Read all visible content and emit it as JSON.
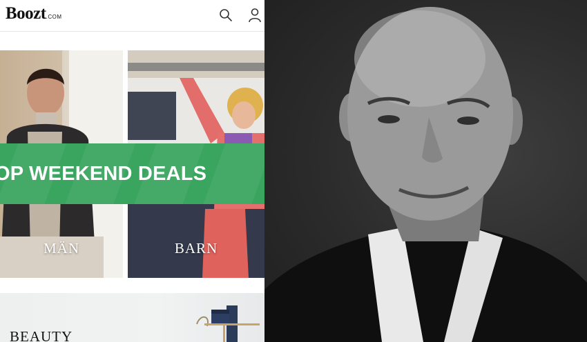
{
  "app": {
    "logo_text": "Boozt",
    "logo_suffix": ".COM"
  },
  "header": {
    "icons": [
      "search-icon",
      "user-icon"
    ]
  },
  "tiles": [
    {
      "label": "MÄN"
    },
    {
      "label": "BARN"
    },
    {
      "label": "BEAUTY"
    }
  ],
  "banner": {
    "text": "OP WEEKEND DEALS",
    "color": "#3aa55f"
  },
  "colors": {
    "accent_green": "#3aa55f",
    "text_dark": "#111111"
  }
}
